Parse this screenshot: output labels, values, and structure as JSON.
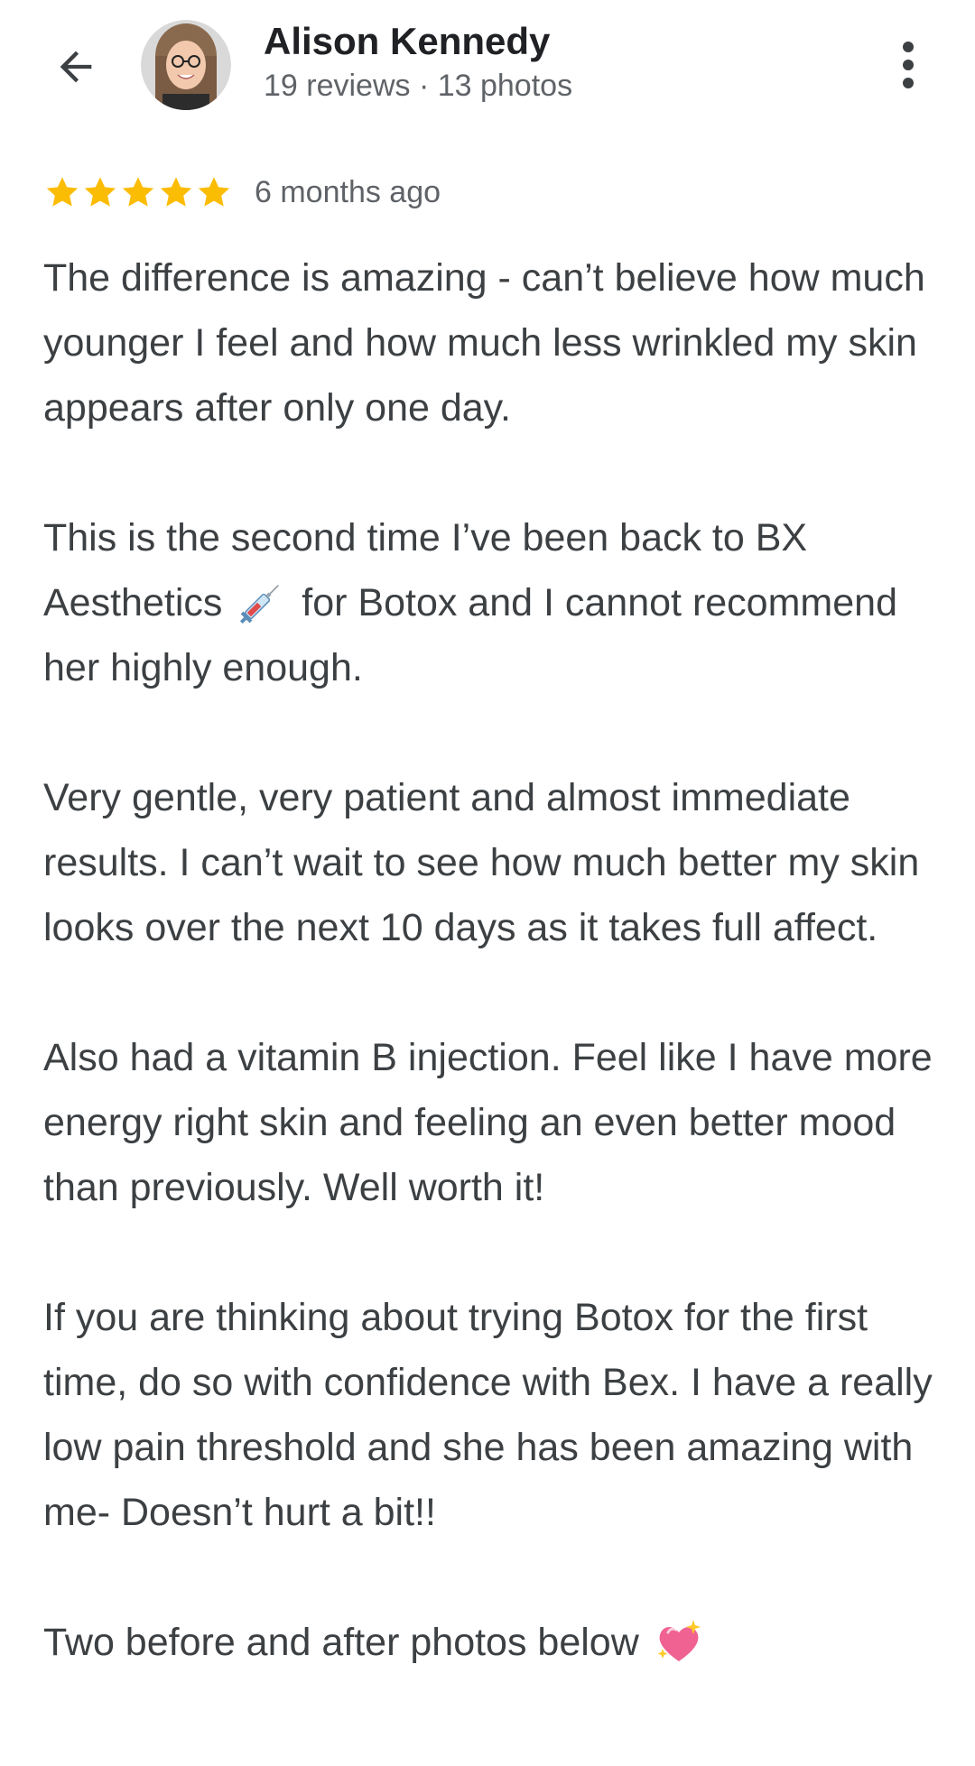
{
  "header": {
    "back_icon": "arrow-back-icon",
    "reviewer_name": "Alison Kennedy",
    "reviewer_meta": "19 reviews · 13 photos",
    "more_icon": "more-vert-icon"
  },
  "review": {
    "rating": 5,
    "rating_max": 5,
    "star_color": "#fbbc04",
    "time": "6 months ago",
    "paragraphs": [
      {
        "text": "The difference is amazing - can’t believe how much younger I feel and how much less wrinkled my skin appears after only one day."
      },
      {
        "text_before": "This is the second time I’ve been back to BX Aesthetics",
        "emoji": "syringe-emoji",
        "text_after": "for Botox and I cannot recommend her highly enough."
      },
      {
        "text": "Very gentle, very patient and almost immediate results. I can’t wait to see how much better my skin looks over the next 10 days as it takes full affect."
      },
      {
        "text": "Also had a vitamin B injection. Feel like I have more energy right skin and feeling an even better mood than previously. Well worth it!"
      },
      {
        "text": "If you are thinking about trying Botox for the first time, do so with confidence with Bex. I have a really low pain threshold and she has been amazing with me- Doesn’t hurt a bit!!"
      },
      {
        "text_before": "Two before and after photos below",
        "emoji": "sparkling-heart-emoji"
      }
    ]
  },
  "colors": {
    "text_primary": "#202124",
    "text_body": "#3c4043",
    "text_secondary": "#5f6368",
    "star": "#fbbc04"
  }
}
